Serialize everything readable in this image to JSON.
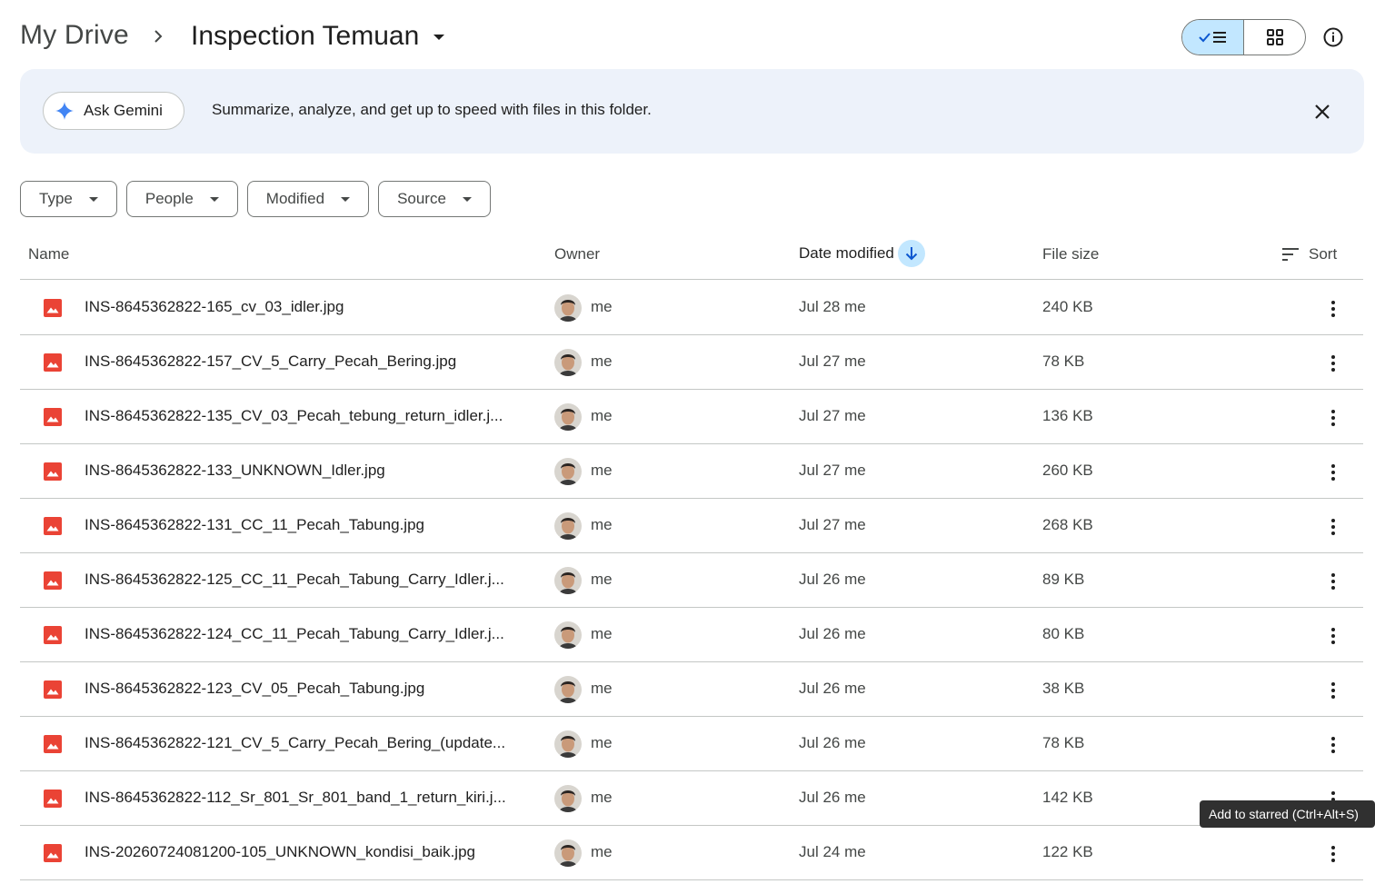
{
  "breadcrumb": {
    "root": "My Drive",
    "current": "Inspection Temuan"
  },
  "banner": {
    "button_label": "Ask Gemini",
    "text": "Summarize, analyze, and get up to speed with files in this folder."
  },
  "filters": [
    "Type",
    "People",
    "Modified",
    "Source"
  ],
  "table": {
    "headers": {
      "name": "Name",
      "owner": "Owner",
      "date": "Date modified",
      "size": "File size",
      "sort": "Sort"
    },
    "rows": [
      {
        "name": "INS-8645362822-165_cv_03_idler.jpg",
        "owner": "me",
        "date": "Jul 28 me",
        "size": "240 KB"
      },
      {
        "name": "INS-8645362822-157_CV_5_Carry_Pecah_Bering.jpg",
        "owner": "me",
        "date": "Jul 27 me",
        "size": "78 KB"
      },
      {
        "name": "INS-8645362822-135_CV_03_Pecah_tebung_return_idler.j...",
        "owner": "me",
        "date": "Jul 27 me",
        "size": "136 KB"
      },
      {
        "name": "INS-8645362822-133_UNKNOWN_Idler.jpg",
        "owner": "me",
        "date": "Jul 27 me",
        "size": "260 KB"
      },
      {
        "name": "INS-8645362822-131_CC_11_Pecah_Tabung.jpg",
        "owner": "me",
        "date": "Jul 27 me",
        "size": "268 KB"
      },
      {
        "name": "INS-8645362822-125_CC_11_Pecah_Tabung_Carry_Idler.j...",
        "owner": "me",
        "date": "Jul 26 me",
        "size": "89 KB"
      },
      {
        "name": "INS-8645362822-124_CC_11_Pecah_Tabung_Carry_Idler.j...",
        "owner": "me",
        "date": "Jul 26 me",
        "size": "80 KB"
      },
      {
        "name": "INS-8645362822-123_CV_05_Pecah_Tabung.jpg",
        "owner": "me",
        "date": "Jul 26 me",
        "size": "38 KB"
      },
      {
        "name": "INS-8645362822-121_CV_5_Carry_Pecah_Bering_(update...",
        "owner": "me",
        "date": "Jul 26 me",
        "size": "78 KB"
      },
      {
        "name": "INS-8645362822-112_Sr_801_Sr_801_band_1_return_kiri.j...",
        "owner": "me",
        "date": "Jul 26 me",
        "size": "142 KB"
      },
      {
        "name": "INS-20260724081200-105_UNKNOWN_kondisi_baik.jpg",
        "owner": "me",
        "date": "Jul 24 me",
        "size": "122 KB"
      }
    ]
  },
  "tooltip": "Add to starred (Ctrl+Alt+S)",
  "colors": {
    "accent": "#c2e7ff",
    "image_icon": "#ea4335",
    "banner_bg": "#edf2fa",
    "tooltip_bg": "#303030"
  },
  "icons": [
    "chevron-right-icon",
    "caret-down-icon",
    "checkmark-icon",
    "list-view-icon",
    "grid-view-icon",
    "info-icon",
    "gemini-sparkle-icon",
    "close-icon",
    "arrow-down-icon",
    "sort-icon",
    "image-file-icon",
    "more-vert-icon"
  ]
}
